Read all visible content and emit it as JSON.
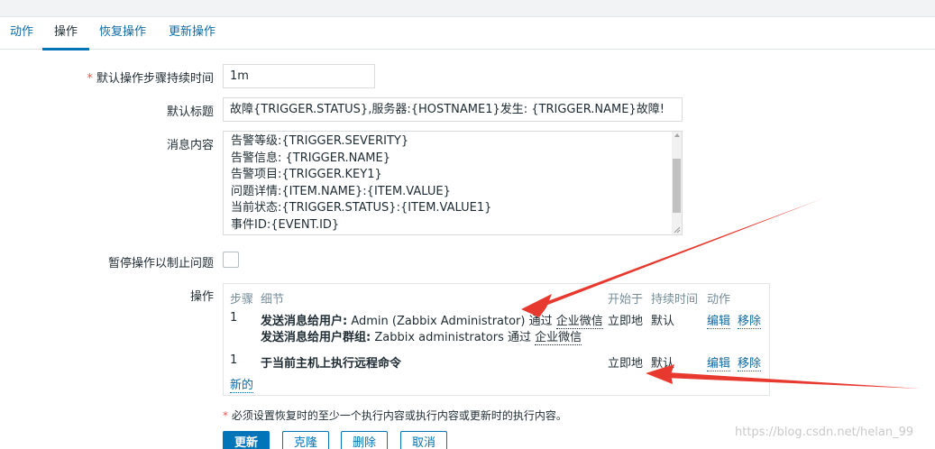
{
  "tabs": [
    {
      "label": "动作"
    },
    {
      "label": "操作"
    },
    {
      "label": "恢复操作"
    },
    {
      "label": "更新操作"
    }
  ],
  "form": {
    "step_duration": {
      "required_mark": "*",
      "label": "默认操作步骤持续时间",
      "value": "1m"
    },
    "subject": {
      "label": "默认标题",
      "value": "故障{TRIGGER.STATUS},服务器:{HOSTNAME1}发生: {TRIGGER.NAME}故障!"
    },
    "message": {
      "label": "消息内容",
      "lines": [
        "告警等级:{TRIGGER.SEVERITY}",
        "告警信息: {TRIGGER.NAME}",
        "告警项目:{TRIGGER.KEY1}",
        "问题详情:{ITEM.NAME}:{ITEM.VALUE}",
        "当前状态:{TRIGGER.STATUS}:{ITEM.VALUE1}",
        "事件ID:{EVENT.ID}"
      ]
    },
    "pause": {
      "label": "暂停操作以制止问题",
      "checked": false
    },
    "operations": {
      "label": "操作",
      "headers": {
        "steps": "步骤",
        "details": "细节",
        "start_in": "开始于",
        "duration": "持续时间",
        "action": "动作"
      },
      "rows": [
        {
          "step": "1",
          "line1_bold": "发送消息给用户:",
          "line1_text": " Admin (Zabbix Administrator) 通过 ",
          "line1_media": "企业微信",
          "line2_bold": "发送消息给用户群组:",
          "line2_text": " Zabbix administrators 通过 ",
          "line2_media": "企业微信",
          "start_in": "立即地",
          "duration": "默认",
          "edit": "编辑",
          "remove": "移除"
        },
        {
          "step": "1",
          "line1_bold": "于当前主机上执行远程命令",
          "start_in": "立即地",
          "duration": "默认",
          "edit": "编辑",
          "remove": "移除"
        }
      ],
      "new_link": "新的"
    },
    "hint": {
      "mark": "*",
      "text": " 必须设置恢复时的至少一个执行内容或执行内容或更新时的执行内容。"
    }
  },
  "buttons": {
    "update": "更新",
    "clone": "克隆",
    "delete": "删除",
    "cancel": "取消"
  },
  "watermark": "https://blog.csdn.net/helan_99",
  "colors": {
    "accent": "#0275b8",
    "link": "#0f6ba3",
    "required": "#e45959",
    "annotation_arrow": "#e8392f"
  }
}
